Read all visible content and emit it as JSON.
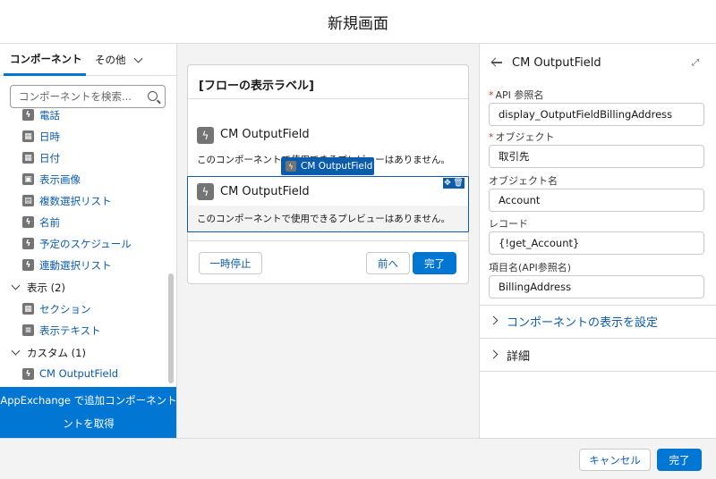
{
  "modal": {
    "title": "新規画面"
  },
  "left": {
    "tabs": {
      "components": "コンポーネント",
      "other": "その他"
    },
    "search_placeholder": "コンポーネントを検索...",
    "items_top": [
      {
        "label": "電話",
        "icon": "bolt-icon"
      },
      {
        "label": "日時",
        "icon": "calendar-icon"
      },
      {
        "label": "日付",
        "icon": "calendar-icon"
      },
      {
        "label": "表示画像",
        "icon": "image-icon"
      },
      {
        "label": "複数選択リスト",
        "icon": "multiselect-icon"
      },
      {
        "label": "名前",
        "icon": "bolt-icon"
      },
      {
        "label": "予定のスケジュール",
        "icon": "bolt-icon"
      },
      {
        "label": "連動選択リスト",
        "icon": "bolt-icon"
      }
    ],
    "group_display": {
      "label": "表示 (2)"
    },
    "items_display": [
      {
        "label": "セクション",
        "icon": "section-icon"
      },
      {
        "label": "表示テキスト",
        "icon": "text-icon"
      }
    ],
    "group_custom": {
      "label": "カスタム (1)"
    },
    "items_custom": [
      {
        "label": "CM OutputField",
        "icon": "bolt-icon"
      }
    ],
    "appexchange": {
      "line1": "AppExchange で追加コンポーネント",
      "line2": "ントを取得"
    }
  },
  "canvas": {
    "screen_label": "[フローの表示ラベル]",
    "component1": {
      "name": "CM OutputField",
      "desc": "このコンポーネントで使用できるプレビューはありません。"
    },
    "drag_chip": "CM OutputField",
    "component2": {
      "name": "CM OutputField",
      "desc": "このコンポーネントで使用できるプレビューはありません。"
    },
    "pause_button": "一時停止",
    "prev_button": "前へ",
    "finish_button": "完了"
  },
  "right": {
    "title": "CM OutputField",
    "fields": {
      "api_name": {
        "label": "API 参照名",
        "value": "display_OutputFieldBillingAddress"
      },
      "object": {
        "label": "オブジェクト",
        "value": "取引先"
      },
      "object_name": {
        "label": "オブジェクト名",
        "value": "Account"
      },
      "record": {
        "label": "レコード",
        "value": "{!get_Account}"
      },
      "item_name": {
        "label": "項目名(API参照名)",
        "value": "BillingAddress"
      }
    },
    "section_visibility": "コンポーネントの表示を設定",
    "section_details": "詳細"
  },
  "footer": {
    "cancel": "キャンセル",
    "done": "完了"
  },
  "colors": {
    "brand": "#0176d3",
    "link": "#0b5cab",
    "required": "#c23934"
  }
}
